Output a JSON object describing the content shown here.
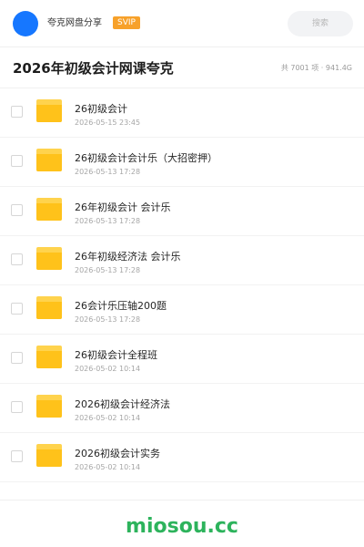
{
  "header": {
    "brand_name": "夸克网盘分享",
    "vip_badge": "SVIP",
    "search_placeholder": "搜索",
    "accent_color": "#1677ff",
    "vip_color": "#f7a12a"
  },
  "title_row": {
    "title": "2026年初级会计网课夸克",
    "summary": "共 7001 项 · 941.4G"
  },
  "files": [
    {
      "name": "26初级会计",
      "date": "2026-05-15 23:45",
      "icon": "folder-icon"
    },
    {
      "name": "26初级会计会计乐（大招密押）",
      "date": "2026-05-13 17:28",
      "icon": "folder-icon"
    },
    {
      "name": "26年初级会计  会计乐",
      "date": "2026-05-13 17:28",
      "icon": "folder-icon"
    },
    {
      "name": "26年初级经济法  会计乐",
      "date": "2026-05-13 17:28",
      "icon": "folder-icon"
    },
    {
      "name": "26会计乐压轴200题",
      "date": "2026-05-13 17:28",
      "icon": "folder-icon"
    },
    {
      "name": "26初级会计全程班",
      "date": "2026-05-02 10:14",
      "icon": "folder-icon"
    },
    {
      "name": "2026初级会计经济法",
      "date": "2026-05-02 10:14",
      "icon": "folder-icon"
    },
    {
      "name": "2026初级会计实务",
      "date": "2026-05-02 10:14",
      "icon": "folder-icon"
    }
  ],
  "footer": {
    "watermark": "miosou.cc",
    "watermark_color": "#2db35c"
  }
}
